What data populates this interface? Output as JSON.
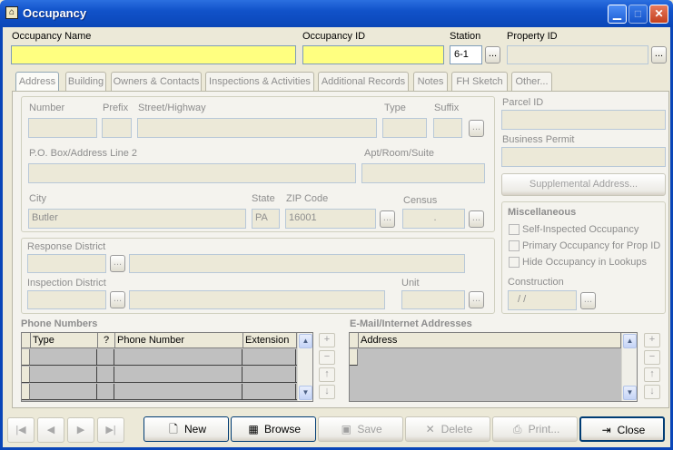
{
  "window": {
    "title": "Occupancy"
  },
  "header": {
    "occupancy_name_label": "Occupancy Name",
    "occupancy_name_value": "",
    "occupancy_id_label": "Occupancy ID",
    "occupancy_id_value": "",
    "station_label": "Station",
    "station_value": "6-1",
    "property_id_label": "Property ID",
    "property_id_value": ""
  },
  "tabs": [
    "Address",
    "Building",
    "Owners & Contacts",
    "Inspections & Activities",
    "Additional Records",
    "Notes",
    "FH Sketch",
    "Other..."
  ],
  "address": {
    "number_label": "Number",
    "prefix_label": "Prefix",
    "street_label": "Street/Highway",
    "type_label": "Type",
    "suffix_label": "Suffix",
    "po_box_label": "P.O. Box/Address Line 2",
    "apt_label": "Apt/Room/Suite",
    "city_label": "City",
    "city_value": "Butler",
    "state_label": "State",
    "state_value": "PA",
    "zip_label": "ZIP Code",
    "zip_value": "16001",
    "census_label": "Census",
    "census_value": "."
  },
  "districts": {
    "response_label": "Response District",
    "inspection_label": "Inspection District",
    "unit_label": "Unit"
  },
  "right_panel": {
    "parcel_label": "Parcel ID",
    "business_permit_label": "Business Permit",
    "supplemental_button": "Supplemental Address...",
    "misc_heading": "Miscellaneous",
    "self_inspected": "Self-Inspected Occupancy",
    "primary_occupancy": "Primary Occupancy for Prop ID",
    "hide_occupancy": "Hide Occupancy in Lookups",
    "construction_label": "Construction",
    "construction_value": "/  /"
  },
  "phone": {
    "heading": "Phone Numbers",
    "columns": [
      "Type",
      "?",
      "Phone Number",
      "Extension"
    ]
  },
  "email": {
    "heading": "E-Mail/Internet Addresses",
    "columns": [
      "Address"
    ]
  },
  "footer": {
    "new": "New",
    "browse": "Browse",
    "save": "Save",
    "delete": "Delete",
    "print": "Print...",
    "close": "Close"
  },
  "icons": {
    "first": "first-record-icon",
    "prev": "previous-record-icon",
    "next": "next-record-icon",
    "last": "last-record-icon"
  },
  "colors": {
    "title_bar": "#0a46b8",
    "required_field": "#ffff80",
    "disabled_text": "#8d8d8d"
  }
}
